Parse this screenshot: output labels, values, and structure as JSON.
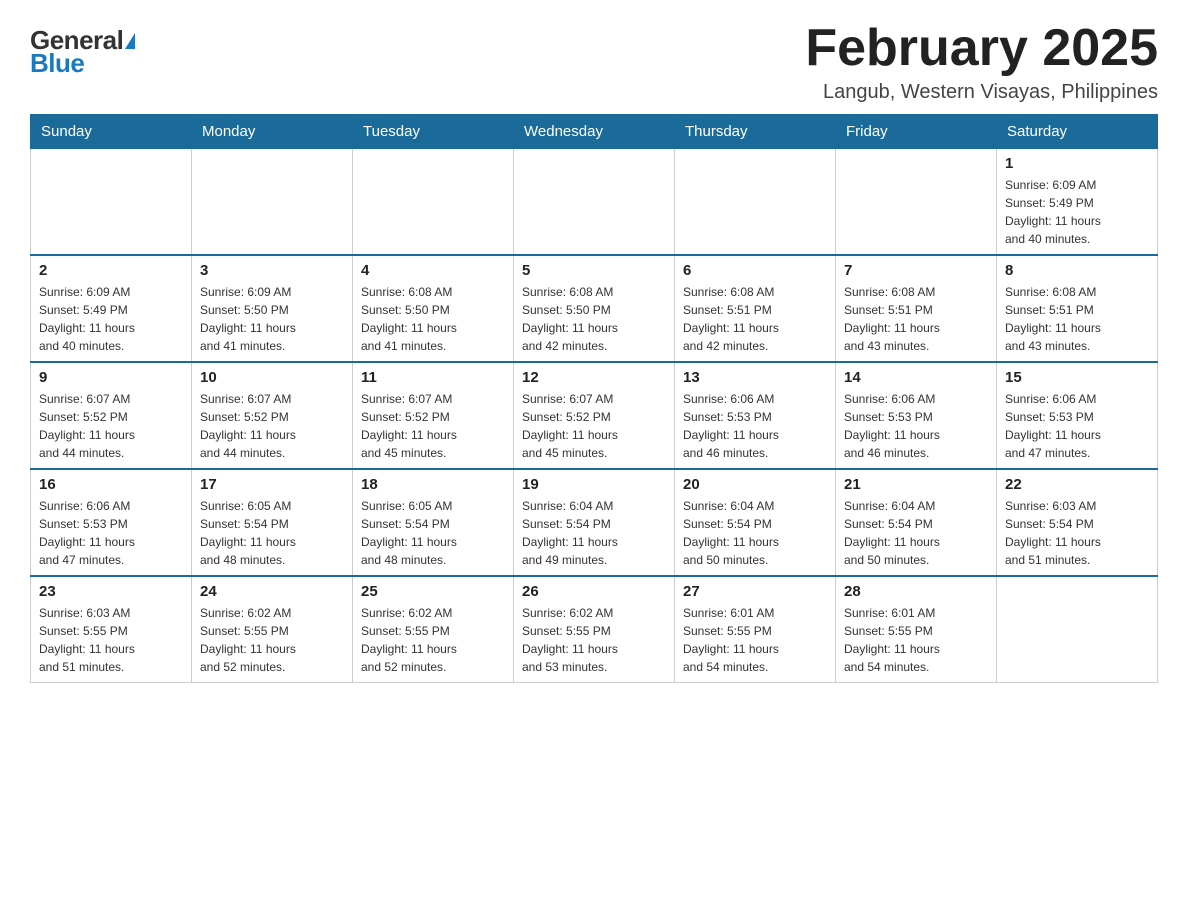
{
  "logo": {
    "general": "General",
    "blue": "Blue"
  },
  "title": "February 2025",
  "location": "Langub, Western Visayas, Philippines",
  "days_of_week": [
    "Sunday",
    "Monday",
    "Tuesday",
    "Wednesday",
    "Thursday",
    "Friday",
    "Saturday"
  ],
  "weeks": [
    [
      {
        "day": "",
        "info": ""
      },
      {
        "day": "",
        "info": ""
      },
      {
        "day": "",
        "info": ""
      },
      {
        "day": "",
        "info": ""
      },
      {
        "day": "",
        "info": ""
      },
      {
        "day": "",
        "info": ""
      },
      {
        "day": "1",
        "info": "Sunrise: 6:09 AM\nSunset: 5:49 PM\nDaylight: 11 hours\nand 40 minutes."
      }
    ],
    [
      {
        "day": "2",
        "info": "Sunrise: 6:09 AM\nSunset: 5:49 PM\nDaylight: 11 hours\nand 40 minutes."
      },
      {
        "day": "3",
        "info": "Sunrise: 6:09 AM\nSunset: 5:50 PM\nDaylight: 11 hours\nand 41 minutes."
      },
      {
        "day": "4",
        "info": "Sunrise: 6:08 AM\nSunset: 5:50 PM\nDaylight: 11 hours\nand 41 minutes."
      },
      {
        "day": "5",
        "info": "Sunrise: 6:08 AM\nSunset: 5:50 PM\nDaylight: 11 hours\nand 42 minutes."
      },
      {
        "day": "6",
        "info": "Sunrise: 6:08 AM\nSunset: 5:51 PM\nDaylight: 11 hours\nand 42 minutes."
      },
      {
        "day": "7",
        "info": "Sunrise: 6:08 AM\nSunset: 5:51 PM\nDaylight: 11 hours\nand 43 minutes."
      },
      {
        "day": "8",
        "info": "Sunrise: 6:08 AM\nSunset: 5:51 PM\nDaylight: 11 hours\nand 43 minutes."
      }
    ],
    [
      {
        "day": "9",
        "info": "Sunrise: 6:07 AM\nSunset: 5:52 PM\nDaylight: 11 hours\nand 44 minutes."
      },
      {
        "day": "10",
        "info": "Sunrise: 6:07 AM\nSunset: 5:52 PM\nDaylight: 11 hours\nand 44 minutes."
      },
      {
        "day": "11",
        "info": "Sunrise: 6:07 AM\nSunset: 5:52 PM\nDaylight: 11 hours\nand 45 minutes."
      },
      {
        "day": "12",
        "info": "Sunrise: 6:07 AM\nSunset: 5:52 PM\nDaylight: 11 hours\nand 45 minutes."
      },
      {
        "day": "13",
        "info": "Sunrise: 6:06 AM\nSunset: 5:53 PM\nDaylight: 11 hours\nand 46 minutes."
      },
      {
        "day": "14",
        "info": "Sunrise: 6:06 AM\nSunset: 5:53 PM\nDaylight: 11 hours\nand 46 minutes."
      },
      {
        "day": "15",
        "info": "Sunrise: 6:06 AM\nSunset: 5:53 PM\nDaylight: 11 hours\nand 47 minutes."
      }
    ],
    [
      {
        "day": "16",
        "info": "Sunrise: 6:06 AM\nSunset: 5:53 PM\nDaylight: 11 hours\nand 47 minutes."
      },
      {
        "day": "17",
        "info": "Sunrise: 6:05 AM\nSunset: 5:54 PM\nDaylight: 11 hours\nand 48 minutes."
      },
      {
        "day": "18",
        "info": "Sunrise: 6:05 AM\nSunset: 5:54 PM\nDaylight: 11 hours\nand 48 minutes."
      },
      {
        "day": "19",
        "info": "Sunrise: 6:04 AM\nSunset: 5:54 PM\nDaylight: 11 hours\nand 49 minutes."
      },
      {
        "day": "20",
        "info": "Sunrise: 6:04 AM\nSunset: 5:54 PM\nDaylight: 11 hours\nand 50 minutes."
      },
      {
        "day": "21",
        "info": "Sunrise: 6:04 AM\nSunset: 5:54 PM\nDaylight: 11 hours\nand 50 minutes."
      },
      {
        "day": "22",
        "info": "Sunrise: 6:03 AM\nSunset: 5:54 PM\nDaylight: 11 hours\nand 51 minutes."
      }
    ],
    [
      {
        "day": "23",
        "info": "Sunrise: 6:03 AM\nSunset: 5:55 PM\nDaylight: 11 hours\nand 51 minutes."
      },
      {
        "day": "24",
        "info": "Sunrise: 6:02 AM\nSunset: 5:55 PM\nDaylight: 11 hours\nand 52 minutes."
      },
      {
        "day": "25",
        "info": "Sunrise: 6:02 AM\nSunset: 5:55 PM\nDaylight: 11 hours\nand 52 minutes."
      },
      {
        "day": "26",
        "info": "Sunrise: 6:02 AM\nSunset: 5:55 PM\nDaylight: 11 hours\nand 53 minutes."
      },
      {
        "day": "27",
        "info": "Sunrise: 6:01 AM\nSunset: 5:55 PM\nDaylight: 11 hours\nand 54 minutes."
      },
      {
        "day": "28",
        "info": "Sunrise: 6:01 AM\nSunset: 5:55 PM\nDaylight: 11 hours\nand 54 minutes."
      },
      {
        "day": "",
        "info": ""
      }
    ]
  ]
}
